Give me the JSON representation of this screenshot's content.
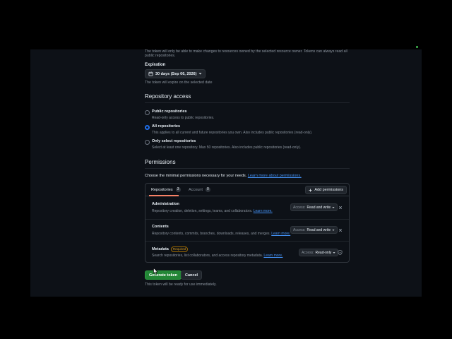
{
  "top_note": "The token will only be able to make changes to resources owned by the selected resource owner. Tokens can always read all public repositories.",
  "expiration": {
    "label": "Expiration",
    "value": "30 days (Sep 06, 2026)",
    "note": "The token will expire on the selected date"
  },
  "repository_access": {
    "title": "Repository access",
    "options": [
      {
        "label": "Public repositories",
        "description": "Read-only access to public repositories.",
        "checked": false
      },
      {
        "label": "All repositories",
        "description": "This applies to all current and future repositories you own. Also includes public repositories (read-only).",
        "checked": true
      },
      {
        "label": "Only select repositories",
        "description": "Select at least one repository. Max 50 repositories. Also includes public repositories (read-only).",
        "checked": false
      }
    ]
  },
  "permissions": {
    "title": "Permissions",
    "intro": "Choose the minimal permissions necessary for your needs.",
    "intro_link": "Learn more about permissions.",
    "tabs": [
      {
        "label": "Repositories",
        "count": "3"
      },
      {
        "label": "Account",
        "count": "0"
      }
    ],
    "add_button": "Add permissions",
    "rows": [
      {
        "name": "Administration",
        "badge": "",
        "description": "Repository creation, deletion, settings, teams, and collaborators.",
        "link": "Learn more.",
        "access_label": "Access:",
        "access_value": "Read and write",
        "removable": true
      },
      {
        "name": "Contents",
        "badge": "",
        "description": "Repository contents, commits, branches, downloads, releases, and merges.",
        "link": "Learn more.",
        "access_label": "Access:",
        "access_value": "Read and write",
        "removable": true
      },
      {
        "name": "Metadata",
        "badge": "Required",
        "description": "Search repositories, list collaborators, and access repository metadata.",
        "link": "Learn more.",
        "access_label": "Access:",
        "access_value": "Read-only",
        "removable": false
      }
    ]
  },
  "actions": {
    "generate": "Generate token",
    "cancel": "Cancel",
    "note": "This token will be ready for use immediately."
  },
  "colors": {
    "background": "#0d1117",
    "primary_button": "#238636",
    "link": "#4493f8",
    "radio_checked": "#1f6feb"
  }
}
